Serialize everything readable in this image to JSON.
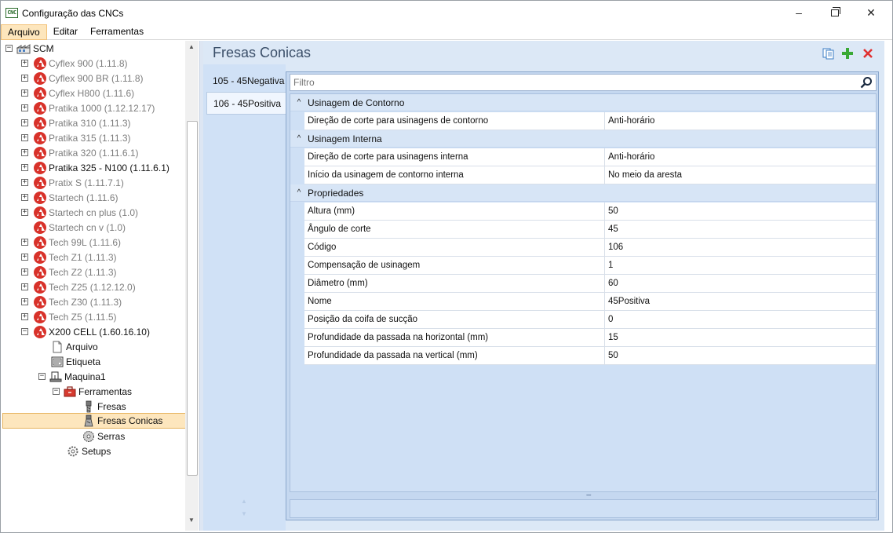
{
  "window": {
    "title": "Configuração das CNCs",
    "app_icon_text": "CNC",
    "controls": {
      "minimize": "–",
      "close": "✕"
    }
  },
  "menu": {
    "items": [
      "Arquivo",
      "Editar",
      "Ferramentas"
    ],
    "active": "Arquivo"
  },
  "tree": {
    "root": "SCM",
    "machines": [
      {
        "label": "Cyflex 900 (1.11.8)",
        "style": "grey",
        "expandable": true
      },
      {
        "label": "Cyflex 900 BR (1.11.8)",
        "style": "grey",
        "expandable": true
      },
      {
        "label": "Cyflex H800 (1.11.6)",
        "style": "grey",
        "expandable": true
      },
      {
        "label": "Pratika 1000 (1.12.12.17)",
        "style": "grey",
        "expandable": true
      },
      {
        "label": "Pratika 310 (1.11.3)",
        "style": "grey",
        "expandable": true
      },
      {
        "label": "Pratika 315 (1.11.3)",
        "style": "grey",
        "expandable": true
      },
      {
        "label": "Pratika 320 (1.11.6.1)",
        "style": "grey",
        "expandable": true
      },
      {
        "label": "Pratika 325 - N100 (1.11.6.1)",
        "style": "dark",
        "expandable": true
      },
      {
        "label": "Pratix S (1.11.7.1)",
        "style": "grey",
        "expandable": true
      },
      {
        "label": "Startech (1.11.6)",
        "style": "grey",
        "expandable": true
      },
      {
        "label": "Startech cn plus (1.0)",
        "style": "grey",
        "expandable": true
      },
      {
        "label": "Startech cn v (1.0)",
        "style": "grey",
        "expandable": false
      },
      {
        "label": "Tech 99L (1.11.6)",
        "style": "grey",
        "expandable": true
      },
      {
        "label": "Tech Z1 (1.11.3)",
        "style": "grey",
        "expandable": true
      },
      {
        "label": "Tech Z2 (1.11.3)",
        "style": "grey",
        "expandable": true
      },
      {
        "label": "Tech Z25 (1.12.12.0)",
        "style": "grey",
        "expandable": true
      },
      {
        "label": "Tech Z30 (1.11.3)",
        "style": "grey",
        "expandable": true
      },
      {
        "label": "Tech Z5 (1.11.5)",
        "style": "grey",
        "expandable": true
      },
      {
        "label": "X200 CELL (1.60.16.10)",
        "style": "dark",
        "expandable": true
      }
    ],
    "x200_children": {
      "arquivo": "Arquivo",
      "etiqueta": "Etiqueta",
      "maquina": "Maquina1",
      "ferramentas": "Ferramentas",
      "fresas": "Fresas",
      "fresas_conicas": "Fresas Conicas",
      "serras": "Serras",
      "setups": "Setups"
    },
    "selected": "Fresas Conicas"
  },
  "content": {
    "title": "Fresas Conicas",
    "toolbar": {
      "copy_icon": "copy-icon",
      "add_icon": "add-icon",
      "delete_icon": "delete-icon"
    },
    "tabs": [
      "105 - 45Negativa",
      "106 - 45Positiva"
    ],
    "selected_tab": "106 - 45Positiva",
    "filter": {
      "placeholder": "Filtro"
    },
    "categories": [
      {
        "name": "Usinagem de Contorno",
        "rows": [
          {
            "name": "Direção de corte para usinagens de contorno",
            "value": "Anti-horário"
          }
        ]
      },
      {
        "name": "Usinagem Interna",
        "rows": [
          {
            "name": "Direção de corte para usinagens interna",
            "value": "Anti-horário"
          },
          {
            "name": "Início da usinagem de contorno interna",
            "value": "No meio da aresta"
          }
        ]
      },
      {
        "name": "Propriedades",
        "rows": [
          {
            "name": "Altura (mm)",
            "value": "50"
          },
          {
            "name": "Ângulo de corte",
            "value": "45"
          },
          {
            "name": "Código",
            "value": "106"
          },
          {
            "name": "Compensação de usinagem",
            "value": "1"
          },
          {
            "name": "Diâmetro (mm)",
            "value": "60"
          },
          {
            "name": "Nome",
            "value": "45Positiva"
          },
          {
            "name": "Posição da coifa de sucção",
            "value": "0"
          },
          {
            "name": "Profundidade da passada na horizontal (mm)",
            "value": "15"
          },
          {
            "name": "Profundidade da passada na vertical (mm)",
            "value": "50"
          }
        ]
      }
    ]
  },
  "colors": {
    "accent_selection": "#fde6bd",
    "panel_blue": "#dce8f6",
    "title_text": "#3b4f69",
    "cnc_logo_red": "#d8322a",
    "add_green": "#3aa935",
    "delete_red": "#e03030"
  }
}
